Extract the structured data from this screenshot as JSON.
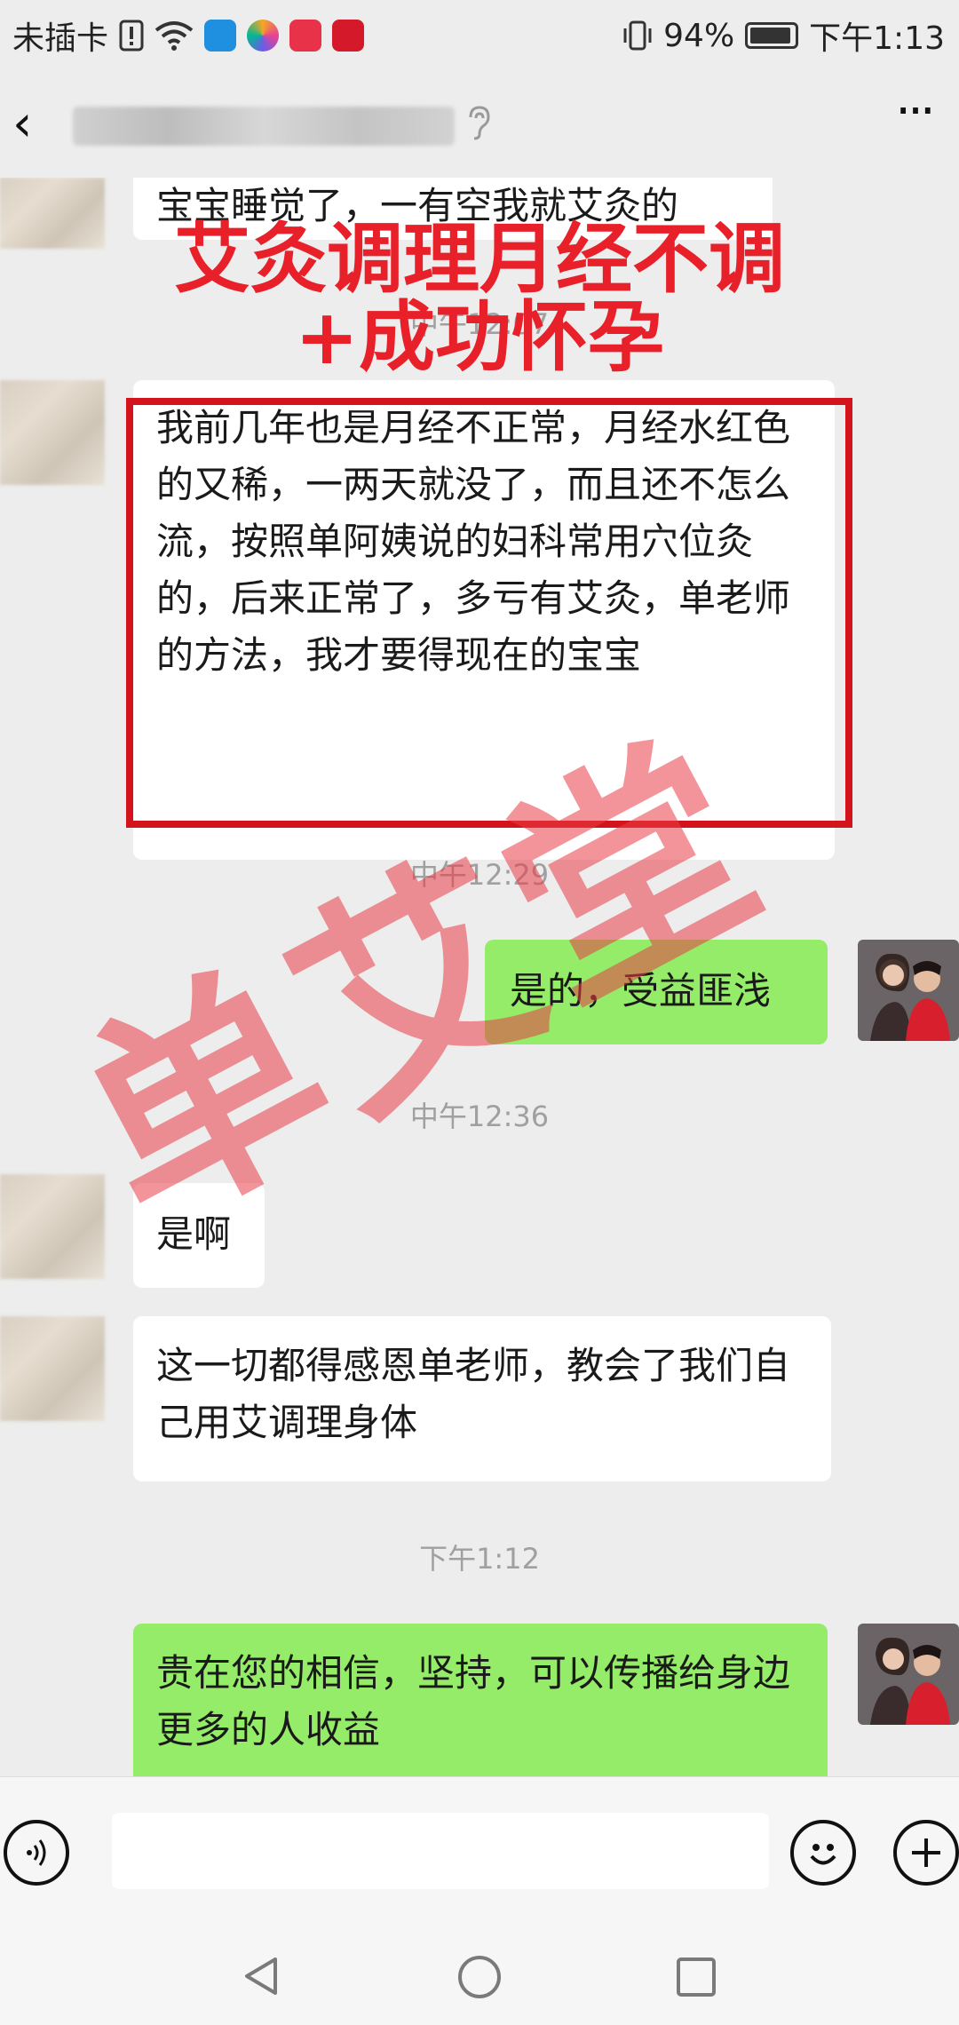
{
  "statusbar": {
    "carrier": "未插卡",
    "battery": "94%",
    "time": "下午1:13",
    "battery_level": 0.94
  },
  "header": {
    "contact_name_obscured": ""
  },
  "overlay": {
    "headline_line1": "艾灸调理月经不调",
    "headline_line2": "+成功怀孕",
    "watermark": "单艾堂"
  },
  "messages": {
    "m0_partial": "宝宝睡觉了，一有空我就艾灸的",
    "t1": "中午12:07",
    "m1": "我前几年也是月经不正常，月经水红色的又稀，一两天就没了，而且还不怎么流，按照单阿姨说的妇科常用穴位灸的，后来正常了，多亏有艾灸，单老师的方法，我才要得现在的宝宝",
    "t2": "中午12:29",
    "m2": "是的，受益匪浅",
    "t3": "中午12:36",
    "m3": "是啊",
    "m4": "这一切都得感恩单老师，教会了我们自己用艾调理身体",
    "t4": "下午1:12",
    "m5": "贵在您的相信，坚持，可以传播给身边更多的人收益"
  },
  "colors": {
    "background": "#ededed",
    "self_bubble": "#95ec69",
    "other_bubble": "#ffffff",
    "headline_red": "#e8202a"
  },
  "icons": [
    "sim-alert-icon",
    "wifi-icon",
    "shield-app-icon",
    "colorful-app-icon",
    "mall-app-icon",
    "huawei-app-icon",
    "vibrate-icon",
    "battery-icon",
    "back-arrow-icon",
    "ear-icon",
    "more-icon",
    "voice-icon",
    "emoji-icon",
    "plus-icon",
    "nav-back-icon",
    "nav-home-icon",
    "nav-recent-icon"
  ]
}
